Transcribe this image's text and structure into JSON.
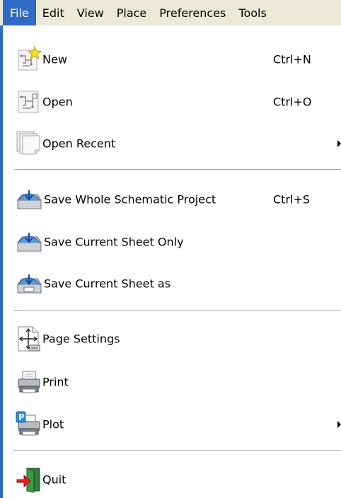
{
  "menubar": {
    "items": [
      {
        "label": "File",
        "active": true
      },
      {
        "label": "Edit"
      },
      {
        "label": "View"
      },
      {
        "label": "Place"
      },
      {
        "label": "Preferences"
      },
      {
        "label": "Tools"
      }
    ]
  },
  "file_menu": {
    "new": {
      "label": "New",
      "shortcut": "Ctrl+N",
      "icon": "new-schematic-icon"
    },
    "open": {
      "label": "Open",
      "shortcut": "Ctrl+O",
      "icon": "open-schematic-icon"
    },
    "open_recent": {
      "label": "Open Recent",
      "icon": "recent-files-icon",
      "has_submenu": true
    },
    "save_project": {
      "label": "Save Whole Schematic Project",
      "shortcut": "Ctrl+S",
      "icon": "save-icon"
    },
    "save_sheet": {
      "label": "Save Current Sheet Only",
      "icon": "save-icon"
    },
    "save_sheet_as": {
      "label": "Save Current Sheet as",
      "icon": "save-as-icon"
    },
    "page_settings": {
      "label": "Page Settings",
      "icon": "page-settings-icon"
    },
    "print": {
      "label": "Print",
      "icon": "printer-icon"
    },
    "plot": {
      "label": "Plot",
      "icon": "plot-icon",
      "has_submenu": true
    },
    "quit": {
      "label": "Quit",
      "icon": "quit-icon"
    }
  },
  "colors": {
    "selection": "#316ac5",
    "menubar_bg": "#ece9d8",
    "separator": "#a9a9a9"
  }
}
